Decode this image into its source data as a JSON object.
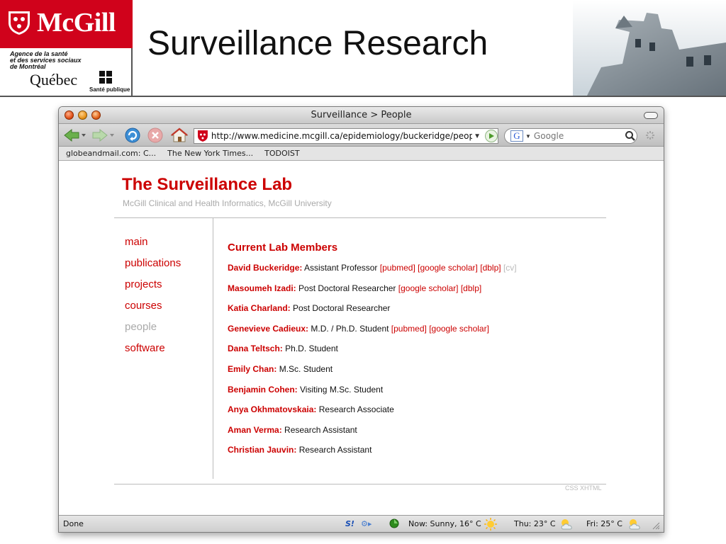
{
  "slide": {
    "title": "Surveillance Research",
    "logo": {
      "mcgill": "McGill",
      "agence_line1": "Agence de la santé",
      "agence_line2": "et des services sociaux",
      "agence_line3": "de Montréal",
      "quebec": "Québec",
      "sante": "Santé publique"
    }
  },
  "browser": {
    "window_title": "Surveillance > People",
    "url": "http://www.medicine.mcgill.ca/epidemiology/buckeridge/peopl",
    "search_placeholder": "Google",
    "bookmarks": [
      "globeandmail.com: C...",
      "The New York Times...",
      "TODOIST"
    ],
    "status": {
      "done": "Done",
      "now": "Now: Sunny, 16° C",
      "thu": "Thu: 23° C",
      "fri": "Fri: 25° C"
    }
  },
  "page": {
    "lab_title": "The Surveillance Lab",
    "lab_subtitle": "McGill Clinical and Health Informatics, McGill University",
    "nav": [
      {
        "label": "main",
        "current": false
      },
      {
        "label": "publications",
        "current": false
      },
      {
        "label": "projects",
        "current": false
      },
      {
        "label": "courses",
        "current": false
      },
      {
        "label": "people",
        "current": true
      },
      {
        "label": "software",
        "current": false
      }
    ],
    "heading": "Current Lab Members",
    "members": [
      {
        "name": "David Buckeridge:",
        "role": "Assistant Professor",
        "links": [
          {
            "t": "[pubmed]"
          },
          {
            "t": "[google scholar]"
          },
          {
            "t": "[dblp]"
          },
          {
            "t": "[cv]",
            "dim": true
          }
        ]
      },
      {
        "name": "Masoumeh Izadi:",
        "role": "Post Doctoral Researcher",
        "links": [
          {
            "t": "[google scholar]"
          },
          {
            "t": "[dblp]"
          }
        ]
      },
      {
        "name": "Katia Charland:",
        "role": "Post Doctoral Researcher",
        "links": []
      },
      {
        "name": "Genevieve Cadieux:",
        "role": "M.D. / Ph.D. Student",
        "links": [
          {
            "t": "[pubmed]"
          },
          {
            "t": "[google scholar]"
          }
        ]
      },
      {
        "name": "Dana Teltsch:",
        "role": "Ph.D. Student",
        "links": []
      },
      {
        "name": "Emily Chan:",
        "role": "M.Sc. Student",
        "links": []
      },
      {
        "name": "Benjamin Cohen:",
        "role": "Visiting M.Sc. Student",
        "links": []
      },
      {
        "name": "Anya Okhmatovskaia:",
        "role": "Research Associate",
        "links": []
      },
      {
        "name": "Aman Verma:",
        "role": "Research Assistant",
        "links": []
      },
      {
        "name": "Christian Jauvin:",
        "role": "Research Assistant",
        "links": []
      }
    ],
    "footer": "CSS XHTML"
  }
}
